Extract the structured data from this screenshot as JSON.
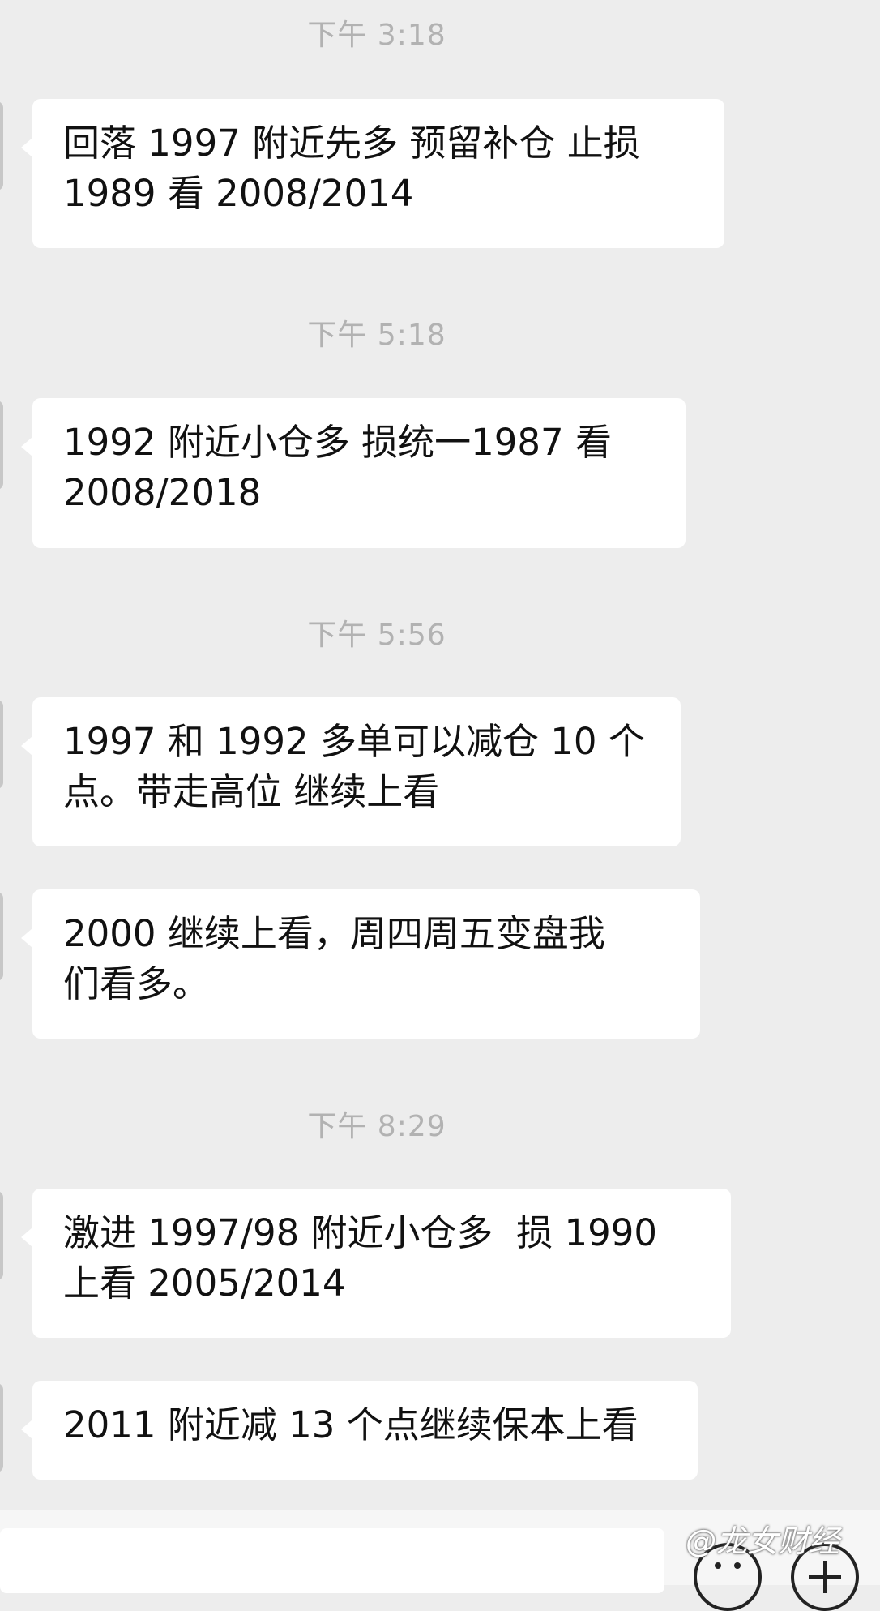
{
  "messages": [
    {
      "time": "下午 3:18",
      "text": "回落 1997 附近先多 预留补仓 止损\n1989 看 2008/2014"
    },
    {
      "time": "下午 5:18",
      "text": "1992 附近小仓多 损统一1987 看\n2008/2018"
    },
    {
      "time": "下午 5:56",
      "text": "1997 和 1992 多单可以减仓 10 个\n点。带走高位 继续上看"
    },
    {
      "time": "",
      "text": "2000 继续上看，周四周五变盘我\n们看多。"
    },
    {
      "time": "下午 8:29",
      "text": "激进 1997/98 附近小仓多  损 1990\n上看 2005/2014"
    },
    {
      "time": "",
      "text": "2011 附近减 13 个点继续保本上看"
    }
  ],
  "watermark": "@龙女财经",
  "colors": {
    "background": "#ededed",
    "bubble": "#ffffff",
    "time_text": "#b2b2b2"
  },
  "icons": {
    "emoji": "emoji-icon",
    "plus": "plus-icon",
    "avatar": "avatar"
  }
}
